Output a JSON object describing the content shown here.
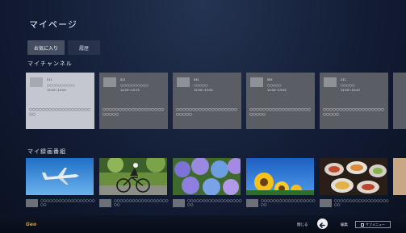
{
  "page_title": "マイページ",
  "tabs": [
    {
      "label": "お気に入り",
      "active": true
    },
    {
      "label": "履歴",
      "active": false
    }
  ],
  "sections": {
    "channels_title": "マイチャンネル",
    "recordings_title": "マイ録画番組"
  },
  "channels": [
    {
      "number": "011",
      "name": "○○○○○○○○○○",
      "time": "13:20～15:00",
      "program": "○○○○○○○○○○○○○○○○○○○○○"
    },
    {
      "number": "021",
      "name": "○○○○○○○○○○",
      "time": "14:25～15:15",
      "program": "○○○○○○○○○○○○○○○○○○○○○○○○"
    },
    {
      "number": "041",
      "name": "○○○○○",
      "time": "15:50～15:50",
      "program": "○○○○○○○○○○○○○○○○○○○○○○○○"
    },
    {
      "number": "081",
      "name": "○○○○○",
      "time": "14:04～15:55",
      "program": "○○○○○○○○○○○○○○○○○○○○○○○○"
    },
    {
      "number": "211",
      "name": "○○○○○",
      "time": "15:20～15:40",
      "program": "○○○○○○○○○○○○○○○○○○○○○○○○"
    }
  ],
  "recordings": [
    {
      "title": "○○○○○○○○○○○○○○○○○○○○",
      "thumb": "airplane"
    },
    {
      "title": "○○○○○○○○○○○○○○○○○○○○",
      "thumb": "cyclist"
    },
    {
      "title": "○○○○○○○○○○○○○○○○○○○○",
      "thumb": "hydrangea"
    },
    {
      "title": "○○○○○○○○○○○○○○○○○○○○",
      "thumb": "sunflower"
    },
    {
      "title": "○○○○○○○○○○○○○○○○○○○○",
      "thumb": "food"
    }
  ],
  "bottom_bar": {
    "brand": "Geo",
    "back_label": "閉じる",
    "back_icon": "back-arrow-icon",
    "edit_label": "編集",
    "menu_label": "サブメニュー"
  },
  "colors": {
    "focus_card": "#c4c7cf",
    "card": "#5b5d64",
    "brand": "#d9a21f"
  }
}
